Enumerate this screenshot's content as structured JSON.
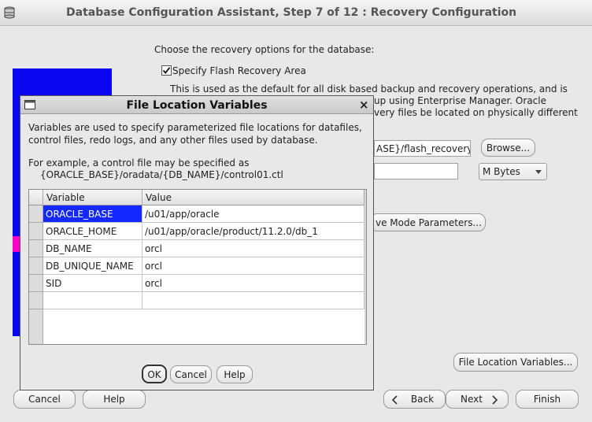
{
  "window": {
    "title": "Database Configuration Assistant, Step 7 of 12 : Recovery Configuration"
  },
  "main": {
    "intro": "Choose the recovery options for the database:",
    "flash_checkbox_label": "Specify Flash Recovery Area",
    "flash_checked": true,
    "desc_line1": "This is used as the default for all disk based backup and recovery operations, and is",
    "desc_line2": "up using Enterprise Manager. Oracle",
    "desc_line3": "very files be located on physically different",
    "location_value": "ASE}/flash_recovery_",
    "browse_label": "Browse...",
    "size_value": "",
    "unit_value": "M Bytes",
    "archive_btn_label": "ve Mode Parameters...",
    "file_loc_btn_label": "File Location Variables..."
  },
  "footer": {
    "cancel": "Cancel",
    "help": "Help",
    "back": "Back",
    "next": "Next",
    "finish": "Finish"
  },
  "dialog": {
    "title": "File Location Variables",
    "text1": "Variables are used to specify parameterized file locations for datafiles,",
    "text2": "control files, redo logs, and any other files used by database.",
    "text3": "For example, a control file may be specified as",
    "text4": "{ORACLE_BASE}/oradata/{DB_NAME}/control01.ctl",
    "columns": [
      "Variable",
      "Value"
    ],
    "rows": [
      {
        "variable": "ORACLE_BASE",
        "value": "/u01/app/oracle"
      },
      {
        "variable": "ORACLE_HOME",
        "value": "/u01/app/oracle/product/11.2.0/db_1"
      },
      {
        "variable": "DB_NAME",
        "value": "orcl"
      },
      {
        "variable": "DB_UNIQUE_NAME",
        "value": "orcl"
      },
      {
        "variable": "SID",
        "value": "orcl"
      },
      {
        "variable": "",
        "value": ""
      }
    ],
    "ok": "OK",
    "cancel": "Cancel",
    "help": "Help",
    "close": "×"
  }
}
